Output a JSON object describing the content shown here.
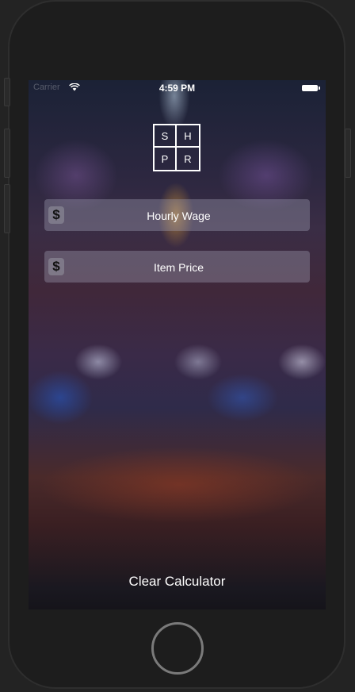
{
  "status_bar": {
    "carrier": "Carrier",
    "time": "4:59 PM",
    "wifi_icon": "wifi-icon",
    "battery_icon": "battery-icon"
  },
  "logo": {
    "letters": [
      "S",
      "H",
      "P",
      "R"
    ]
  },
  "form": {
    "hourly_wage": {
      "currency_symbol": "$",
      "placeholder": "Hourly Wage",
      "value": ""
    },
    "item_price": {
      "currency_symbol": "$",
      "placeholder": "Item Price",
      "value": ""
    }
  },
  "actions": {
    "clear_label": "Clear Calculator"
  },
  "colors": {
    "text": "#ffffff",
    "field_background": "rgba(170,170,190,0.35)",
    "device_bezel": "#1d1d1d"
  }
}
